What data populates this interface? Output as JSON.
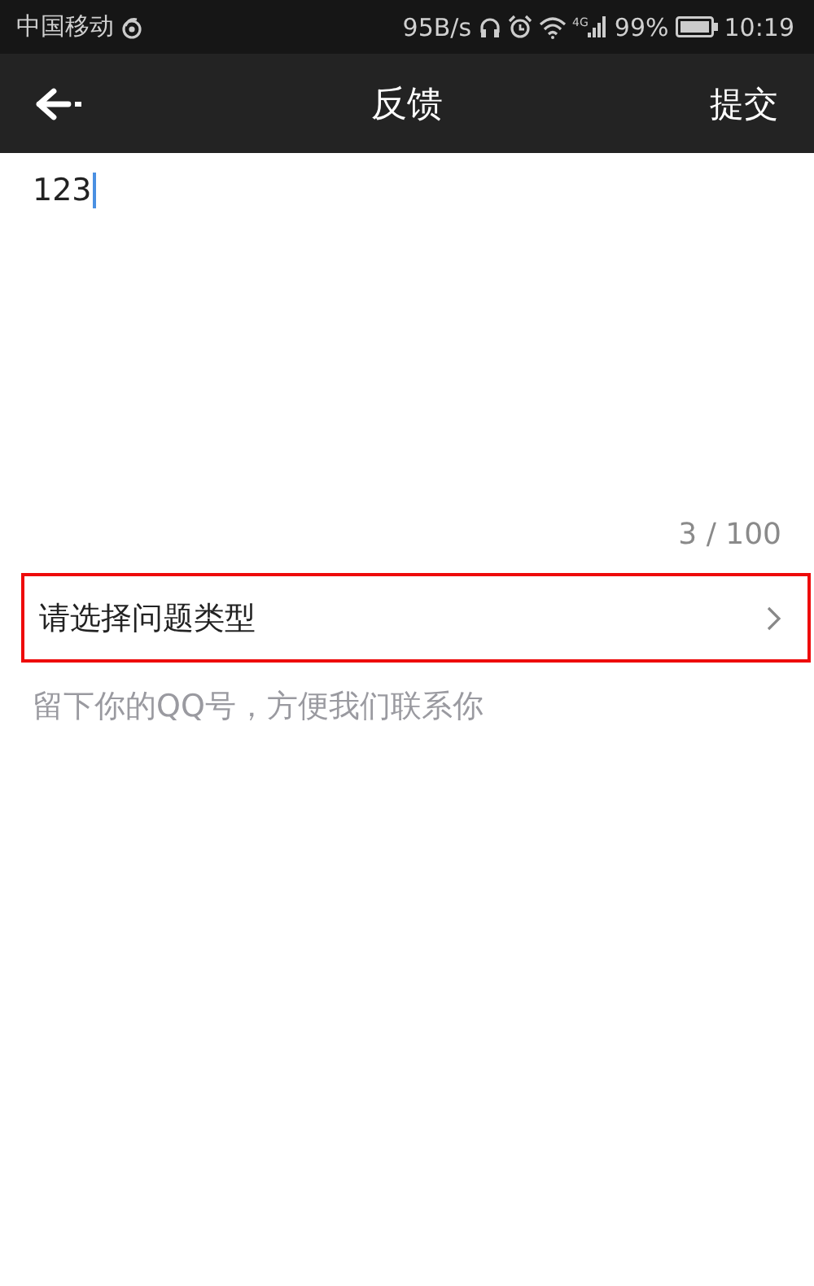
{
  "status_bar": {
    "carrier": "中国移动",
    "speed": "95B/s",
    "network": "4G",
    "battery": "99%",
    "time": "10:19"
  },
  "toolbar": {
    "title": "反馈",
    "action": "提交"
  },
  "feedback": {
    "value": "123",
    "focused": true,
    "counter": "3 / 100"
  },
  "type_row": {
    "label": "请选择问题类型",
    "highlighted": true
  },
  "contact": {
    "placeholder": "留下你的QQ号，方便我们联系你"
  }
}
